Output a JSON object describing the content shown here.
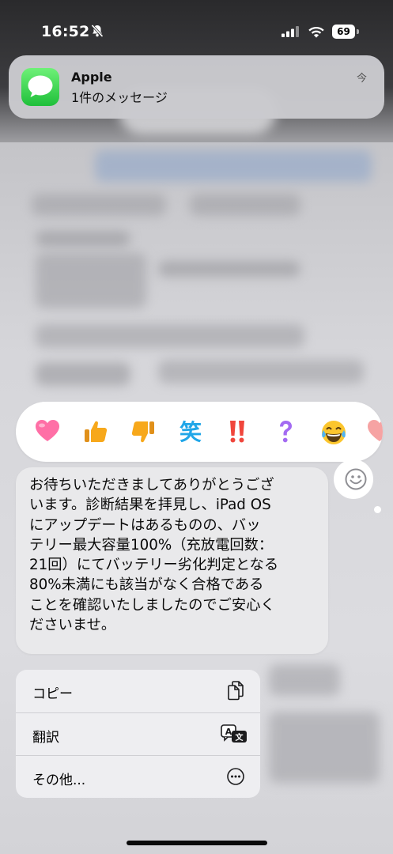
{
  "status_bar": {
    "time": "16:52",
    "battery_level": "69",
    "icons": [
      "silent-icon",
      "signal-icon",
      "wifi-icon",
      "battery-icon"
    ]
  },
  "notification": {
    "app_name": "Apple",
    "body": "1件のメッセージ",
    "time": "今",
    "icon": "messages-icon"
  },
  "reactions": [
    {
      "name": "heart",
      "icon": "heart-icon",
      "glyph": "❤"
    },
    {
      "name": "thumbs-up",
      "icon": "thumbs-up-icon",
      "glyph": "👍"
    },
    {
      "name": "thumbs-down",
      "icon": "thumbs-down-icon",
      "glyph": "👎"
    },
    {
      "name": "laugh",
      "icon": "laugh-icon",
      "glyph": "笑"
    },
    {
      "name": "emphasize",
      "icon": "double-exclamation-icon",
      "glyph": "‼"
    },
    {
      "name": "question",
      "icon": "question-icon",
      "glyph": "?"
    },
    {
      "name": "tears-of-joy",
      "icon": "tears-of-joy-icon",
      "glyph": "😂"
    }
  ],
  "message": {
    "lines": [
      "お待ちいただきましてありがとうござ",
      "います。診断結果を拝見し、iPad OS",
      "にアップデートはあるものの、バッ",
      "テリー最大容量100%（充放電回数：",
      "21回）にてバッテリー劣化判定となる",
      "80%未満にも該当がなく合格である",
      "ことを確認いたしましたのでご安心く",
      "ださいませ。"
    ]
  },
  "menu": {
    "copy_label": "コピー",
    "translate_label": "翻訳",
    "more_label": "その他..."
  },
  "colors": {
    "accent_green": "#2fc844",
    "bubble": "#e9e9eb",
    "reaction_pink": "#ff6fa6",
    "reaction_orange": "#f7a81b",
    "reaction_blue": "#20a6e8",
    "reaction_red": "#f0463c",
    "reaction_purple": "#a36bf2"
  }
}
